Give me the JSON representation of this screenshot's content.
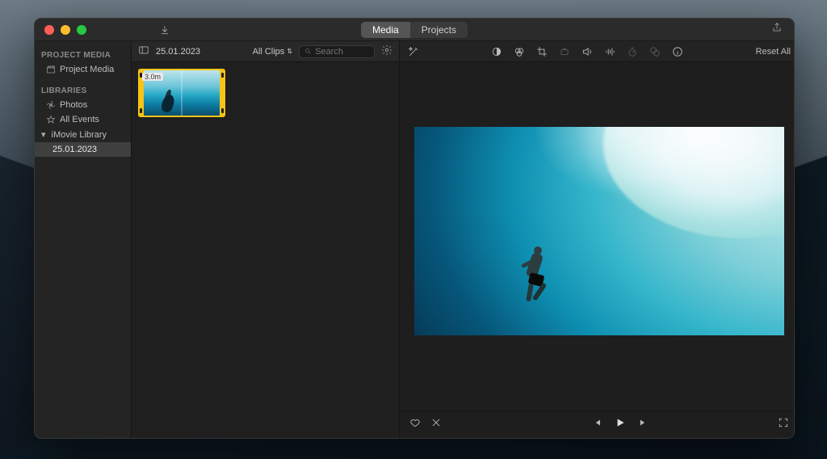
{
  "titlebar": {
    "tabs": {
      "media": "Media",
      "projects": "Projects",
      "active": "media"
    }
  },
  "sidebar": {
    "projectMediaHeading": "PROJECT MEDIA",
    "projectMedia": "Project Media",
    "librariesHeading": "LIBRARIES",
    "photos": "Photos",
    "allEvents": "All Events",
    "library": "iMovie Library",
    "event": "25.01.2023"
  },
  "browser": {
    "title": "25.01.2023",
    "filterLabel": "All Clips",
    "searchPlaceholder": "Search",
    "clipDuration": "3.0m"
  },
  "viewer": {
    "resetAll": "Reset All"
  }
}
